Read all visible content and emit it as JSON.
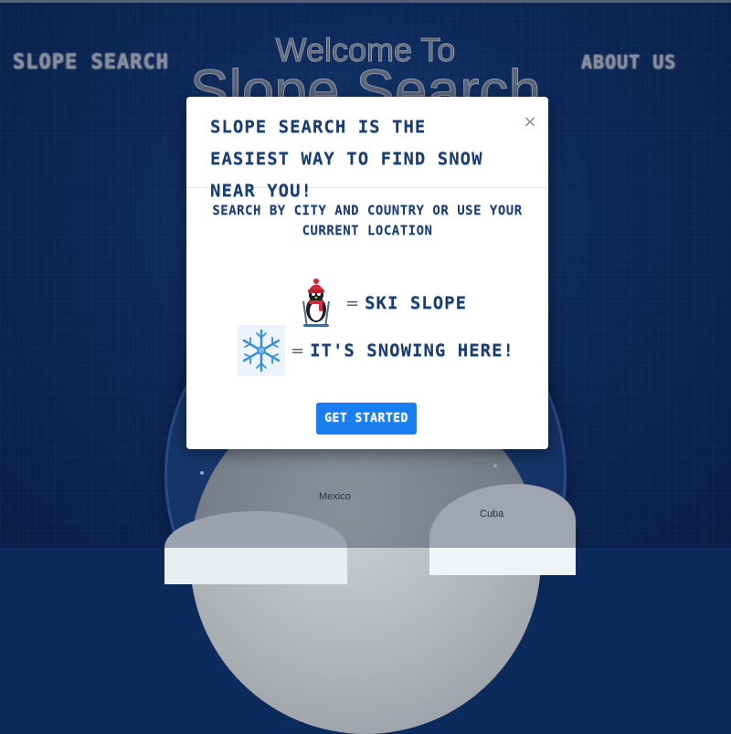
{
  "header": {
    "brand": "SLOPE SEARCH",
    "welcome": "Welcome To",
    "hero": "Slope Search",
    "about": "ABOUT US"
  },
  "background": {
    "map_labels": [
      "Mexico",
      "Cuba"
    ]
  },
  "modal": {
    "title": "SLOPE SEARCH IS THE EASIEST WAY TO FIND SNOW NEAR YOU!",
    "close_label": "×",
    "subtitle": "SEARCH BY CITY AND COUNTRY OR USE YOUR CURRENT LOCATION",
    "legend": [
      {
        "icon": "penguin-skier-icon",
        "equals": "=",
        "label": "SKI SLOPE"
      },
      {
        "icon": "snowflake-icon",
        "equals": "=",
        "label": "IT'S SNOWING HERE!"
      }
    ],
    "cta_label": "GET STARTED"
  },
  "colors": {
    "background": "#0f3471",
    "modal_text": "#1d3c6e",
    "cta": "#1a7df0"
  }
}
